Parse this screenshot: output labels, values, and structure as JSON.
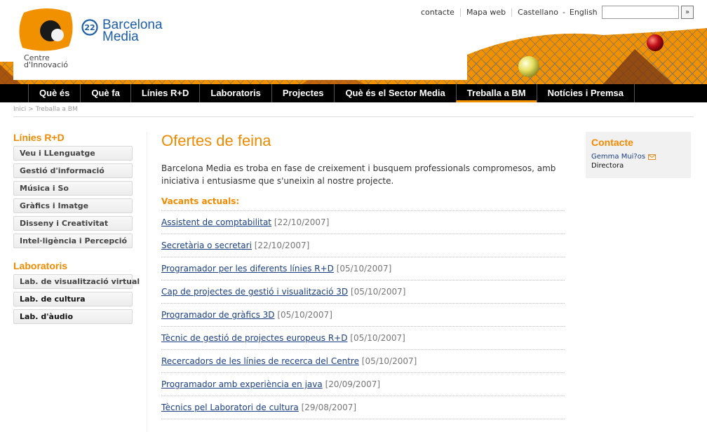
{
  "header": {
    "logo_line1": "Centre",
    "logo_line2": "d'Innovació",
    "badge_number": "22",
    "brand_line1": "Barcelona",
    "brand_line2": "Media",
    "top_links": {
      "contacte": "contacte",
      "mapa_web": "Mapa web",
      "lang_castellano": "Castellano",
      "lang_separator": "-",
      "lang_english": "English"
    },
    "search": {
      "value": "",
      "button_label": "»"
    }
  },
  "nav": {
    "items": [
      {
        "label": "Què és"
      },
      {
        "label": "Què fa"
      },
      {
        "label": "Línies R+D"
      },
      {
        "label": "Laboratoris"
      },
      {
        "label": "Projectes"
      },
      {
        "label": "Què és el Sector Media"
      },
      {
        "label": "Treballa a BM",
        "active": true
      },
      {
        "label": "Notícies i Premsa"
      }
    ]
  },
  "breadcrumb": {
    "home": "Inici",
    "separator": ">",
    "current": "Treballa a BM"
  },
  "sidebar": {
    "lines_title": "Línies R+D",
    "lines": [
      "Veu i LLenguatge",
      "Gestió d'informació",
      "Música i So",
      "Gràfics i Imatge",
      "Disseny i Creativitat",
      "Intel·ligència i Percepció"
    ],
    "labs_title": "Laboratoris",
    "labs": [
      "Lab. de visualització virtual",
      "Lab. de cultura",
      "Lab. d'àudio"
    ]
  },
  "main": {
    "title": "Ofertes de feina",
    "intro": "Barcelona Media es troba en fase de creixement i busquem professionals compromesos, amb iniciativa i entusiasme que s'uneixin al nostre projecte.",
    "vacants_title": "Vacants actuals:",
    "jobs": [
      {
        "title": "Assistent de comptabilitat",
        "date": "[22/10/2007]"
      },
      {
        "title": "Secretària o secretari",
        "date": "[22/10/2007]"
      },
      {
        "title": "Programador per les diferents línies R+D",
        "date": "[05/10/2007]"
      },
      {
        "title": "Cap de projectes de gestió i visualització 3D",
        "date": "[05/10/2007]"
      },
      {
        "title": "Programador de gràfics 3D",
        "date": "[05/10/2007]"
      },
      {
        "title": "Tècnic de gestió de projectes europeus R+D",
        "date": "[05/10/2007]"
      },
      {
        "title": "Recercadors de les línies de recerca del Centre",
        "date": "[05/10/2007]"
      },
      {
        "title": "Programador amb experiència en java",
        "date": "[20/09/2007]"
      },
      {
        "title": "Tècnics pel Laboratori de cultura",
        "date": "[29/08/2007]"
      }
    ]
  },
  "contact": {
    "title": "Contacte",
    "name": "Gemma Mui?os",
    "role": "Directora"
  },
  "colors": {
    "accent": "#f08a00",
    "brand_blue": "#1d5ea8",
    "link": "#1a3f84",
    "nav_bg": "#000000"
  }
}
